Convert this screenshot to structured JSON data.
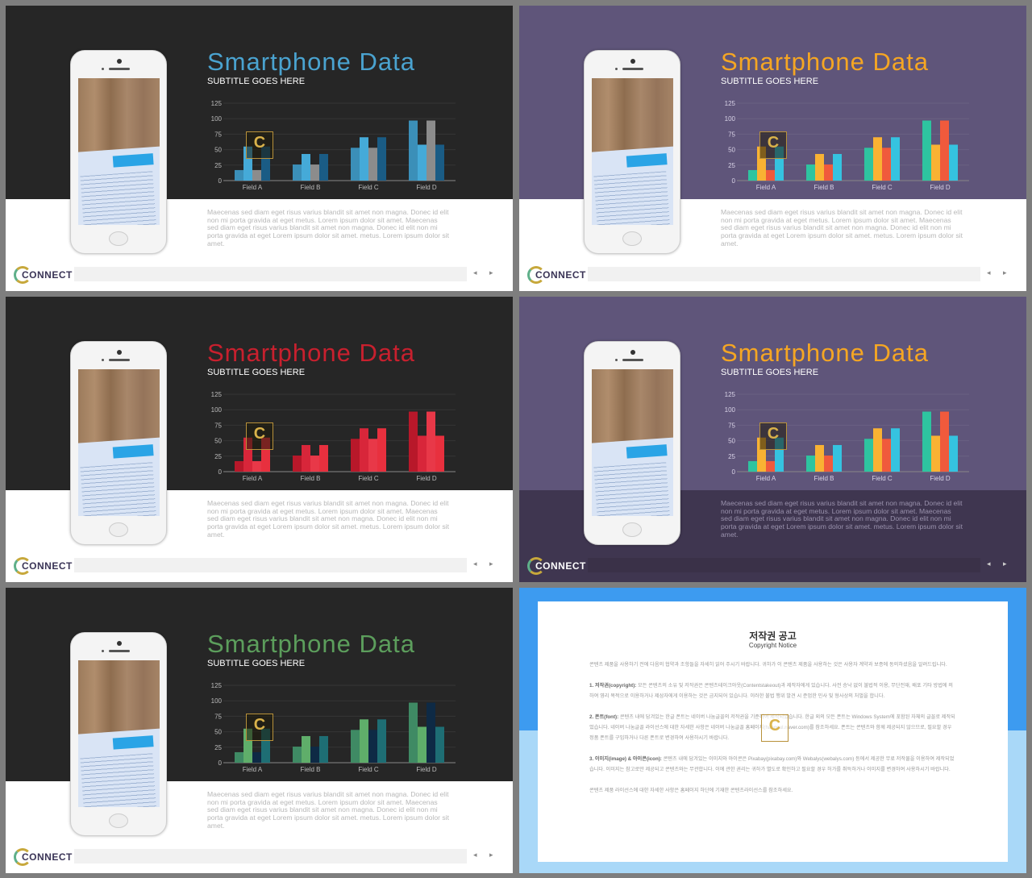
{
  "slides": [
    {
      "title": "Smartphone Data",
      "subtitle": "SUBTITLE GOES HERE",
      "title_color": "#4aa3d0",
      "top_bg": "#262626",
      "bottom_bg": "#ffffff",
      "footer_dark": false,
      "bar_colors": [
        "#3b8fb8",
        "#45aad8",
        "#8c8c8c",
        "#1a5c85"
      ]
    },
    {
      "title": "Smartphone Data",
      "subtitle": "SUBTITLE GOES HERE",
      "title_color": "#f5a623",
      "top_bg": "#5f557a",
      "bottom_bg": "#ffffff",
      "footer_dark": false,
      "bar_colors": [
        "#2ec4a0",
        "#f9b233",
        "#f05a3c",
        "#35c3e0"
      ]
    },
    {
      "title": "Smartphone Data",
      "subtitle": "SUBTITLE GOES HERE",
      "title_color": "#c8202e",
      "top_bg": "#262626",
      "bottom_bg": "#ffffff",
      "footer_dark": false,
      "bar_colors": [
        "#b8182a",
        "#d8263a",
        "#e83848",
        "#e8303e"
      ]
    },
    {
      "title": "Smartphone Data",
      "subtitle": "SUBTITLE GOES HERE",
      "title_color": "#f5a623",
      "top_bg": "#5f557a",
      "bottom_bg": "#3f3650",
      "footer_dark": true,
      "bar_colors": [
        "#2ec4a0",
        "#f9b233",
        "#f05a3c",
        "#35c3e0"
      ]
    },
    {
      "title": "Smartphone Data",
      "subtitle": "SUBTITLE GOES HERE",
      "title_color": "#5c9e5c",
      "top_bg": "#262626",
      "bottom_bg": "#ffffff",
      "footer_dark": false,
      "bar_colors": [
        "#3f8a64",
        "#5fae6a",
        "#0e2a45",
        "#1e6e74"
      ]
    }
  ],
  "paragraph": "Maecenas sed diam eget risus varius blandit sit amet non magna. Donec id elit non mi porta gravida at eget metus. Lorem ipsum dolor sit amet. Maecenas sed diam eget risus varius blandit sit amet non magna. Donec id elit non mi porta gravida at eget Lorem ipsum dolor sit amet. metus. Lorem ipsum dolor sit amet.",
  "footer": {
    "logo": "CONNECT",
    "prev": "◂",
    "next": "▸"
  },
  "watermark": "C",
  "chart_data": {
    "type": "bar",
    "categories": [
      "Field A",
      "Field B",
      "Field C",
      "Field D"
    ],
    "series": [
      {
        "values": [
          17,
          26,
          53,
          97
        ]
      },
      {
        "values": [
          55,
          43,
          70,
          58
        ]
      },
      {
        "values": [
          17,
          26,
          53,
          97
        ]
      },
      {
        "values": [
          55,
          43,
          70,
          58
        ]
      }
    ],
    "yticks": [
      "0",
      "25",
      "50",
      "75",
      "100",
      "125"
    ],
    "ylim": [
      0,
      125
    ],
    "grid": true
  },
  "copyright": {
    "title": "저작권 공고",
    "subtitle": "Copyright Notice",
    "intro": "콘텐츠 제품을 사용하기 전에 다음의 협약과 조항들을 자세히 읽어 주시기 바랍니다. 귀하가 이 콘텐츠 제품을 사용하는 것은 사용자 계약과 보증에 동의하셨음을 알려드립니다.",
    "items": [
      {
        "head": "1. 저작권(copyright):",
        "text": " 모든 콘텐츠의 소유 및 저작권은 콘텐츠테이크아웃(Contentstakeout)과 제작자에게 있습니다. 사전 승낙 없이 불법적 이용, 무단전재, 배포 기타 방법에 의하여 영리 목적으로 이용하거나 제삼자에게 이용하는 것은 금지되어 있습니다. 이러한 불법 행위 발견 시 준엄한 민사 및 형사상의 처벌을 합니다."
      },
      {
        "head": "2. 폰트(font):",
        "text": " 콘텐츠 내에 담겨있는 한글 폰트는 네이버 나눔글꼴의 저작권을 기준하여 제작되었습니다. 한글 외의 모든 폰트는 Windows System에 포함된 자체의 글꼴로 제작되었습니다. 네이버 나눔글꼴 라이선스에 대한 자세한 사항은 네이버 나눔글꼴 홈페이지(hangeul.naver.com)를 참조하세요. 폰트는 콘텐츠와 함께 제공되지 않으므로, 필요할 경우 정품 폰트를 구입하거나 다른 폰트로 변경하여 사용하시기 바랍니다."
      },
      {
        "head": "3. 이미지(image) & 아이콘(icon):",
        "text": " 콘텐츠 내에 담겨있는 이미지와 아이콘은 Pixabay(pixabay.com)와 Webalys(webalys.com) 등에서 제공한 무료 저작물을 이용하여 제작되었습니다. 이미지는 참고로만 제공되고 콘텐츠와는 무관합니다. 이에 관한 권리는 귀하가 별도로 확인하고 필요할 경우 허가를 취득하거나 이미지를 변경하여 사용하시기 바랍니다."
      }
    ],
    "outro": "콘텐츠 제품 라이선스에 대한 자세한 사항은 홈페이지 하단에 기재한 콘텐츠라이선스를 참조하세요.",
    "bg_top": "#3d9bf0",
    "bg_bottom": "#a9d8f8"
  }
}
